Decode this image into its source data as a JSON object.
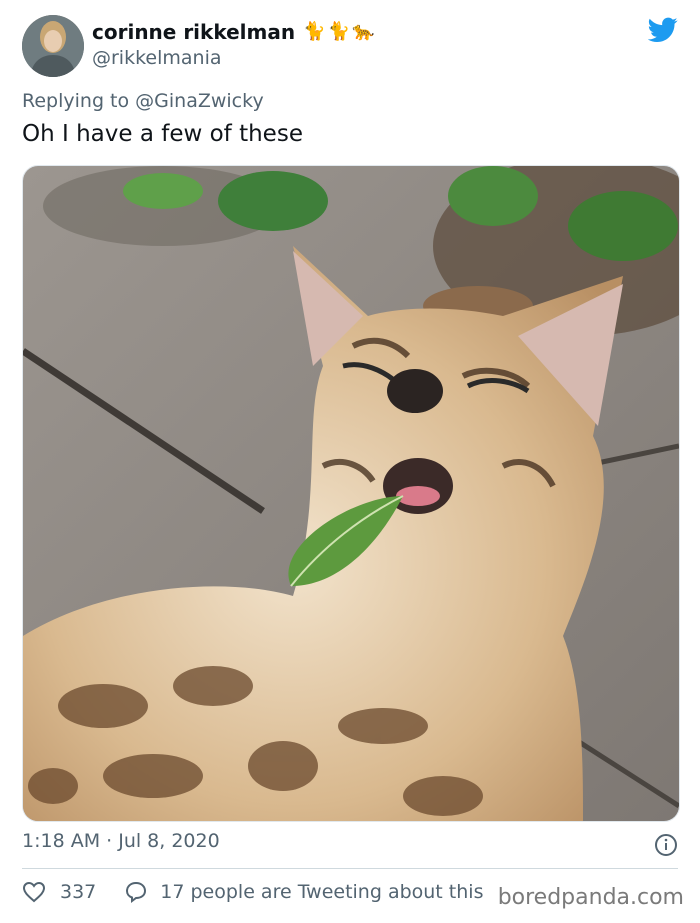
{
  "author": {
    "display_name": "corinne rikkelman",
    "handle": "@rikkelmania",
    "emojis": [
      "🐈",
      "🐈",
      "🐆"
    ]
  },
  "tweet": {
    "replying_to": "Replying to @GinaZwicky",
    "text": "Oh I have a few of these",
    "timestamp": "1:18 AM · Jul 8, 2020"
  },
  "engagement": {
    "likes": "337",
    "tweeting_about": "17 people are Tweeting about this"
  },
  "watermark": "boredpanda.com",
  "colors": {
    "twitter_blue": "#1d9bf0",
    "secondary_text": "#536471",
    "primary_text": "#0f1419"
  },
  "icons": {
    "brand": "twitter-bird-icon",
    "info": "info-circle-icon",
    "like": "heart-icon",
    "reply": "speech-bubble-icon"
  }
}
